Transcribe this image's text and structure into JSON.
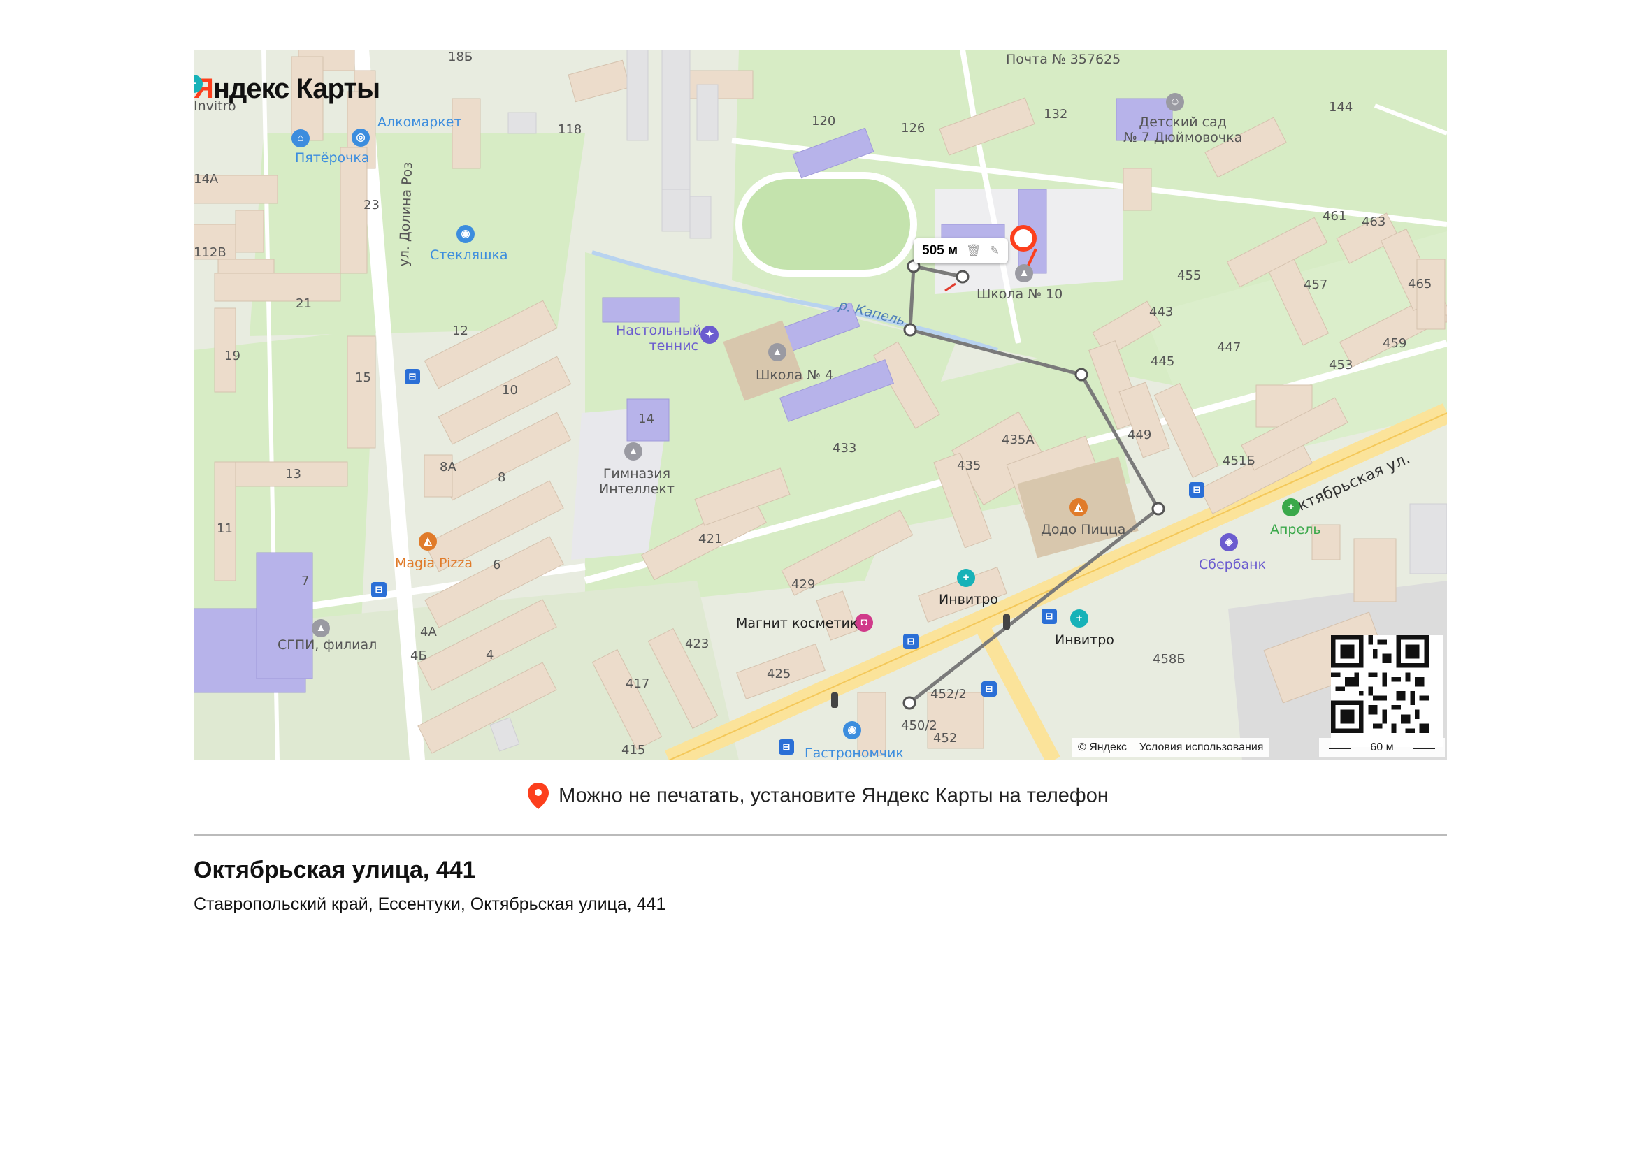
{
  "app": {
    "logo_prefix": "Я",
    "logo_text": "ндекс Карты"
  },
  "map": {
    "measure": {
      "distance": "505 м",
      "delete_icon": "trash-icon",
      "edit_icon": "pencil-icon"
    },
    "street_labels": [
      "ул. Долина Роз",
      "р. Капель",
      "Октябрьская ул."
    ],
    "house_numbers": [
      "18Б",
      "120",
      "126",
      "132",
      "144",
      "118",
      "14А",
      "23",
      "112В",
      "21",
      "19",
      "15",
      "12",
      "10",
      "8А",
      "8",
      "13",
      "11",
      "7",
      "4А",
      "4Б",
      "4",
      "6",
      "14",
      "433",
      "435",
      "435А",
      "443",
      "445",
      "447",
      "449",
      "451Б",
      "453",
      "455",
      "457",
      "459",
      "461",
      "463",
      "465",
      "421",
      "423",
      "425",
      "429",
      "417",
      "415",
      "452/2",
      "450/2",
      "452",
      "458Б"
    ],
    "pois": [
      {
        "name": "Почта № 357625",
        "color": "#555555"
      },
      {
        "name": "Детский сад\n№ 7 Дюймовочка",
        "color": "#555555"
      },
      {
        "name": "Алкомаркет",
        "color": "#3c8dde"
      },
      {
        "name": "Пятёрочка",
        "color": "#3c8dde"
      },
      {
        "name": "Стекляшка",
        "color": "#3c8dde"
      },
      {
        "name": "Invitro",
        "color": "#555555"
      },
      {
        "name": "Настольный теннис",
        "color": "#6b5ccf"
      },
      {
        "name": "Школа № 4",
        "color": "#555555"
      },
      {
        "name": "Школа № 10",
        "color": "#555555"
      },
      {
        "name": "Гимназия\nИнтеллект",
        "color": "#555555"
      },
      {
        "name": "Magia Pizza",
        "color": "#e07b2a"
      },
      {
        "name": "СГПИ, филиал",
        "color": "#555555"
      },
      {
        "name": "Додо Пицца",
        "color": "#555555"
      },
      {
        "name": "Апрель",
        "color": "#3aa84a"
      },
      {
        "name": "Сбербанк",
        "color": "#6b5ccf"
      },
      {
        "name": "Инвитро",
        "color": "#222222"
      },
      {
        "name": "Инвитро",
        "color": "#222222"
      },
      {
        "name": "Магнит косметик",
        "color": "#222222"
      },
      {
        "name": "Гастрономчик",
        "color": "#3c8dde"
      }
    ],
    "copyright": "© Яндекс",
    "terms": "Условия использования",
    "scale": "60 м",
    "colors": {
      "route": "#7a7a7a",
      "pin": "#fc3f1d",
      "water": "#b8d3ef",
      "park": "#d7ecc5",
      "building": "#ecdccb",
      "school": "#b7b3ea",
      "road": "#fbe39a"
    }
  },
  "banner": {
    "text": "Можно не печатать, установите Яндекс Карты на телефон"
  },
  "address": {
    "title": "Октябрьская улица, 441",
    "full": "Ставропольский край, Ессентуки, Октябрьская улица, 441"
  }
}
